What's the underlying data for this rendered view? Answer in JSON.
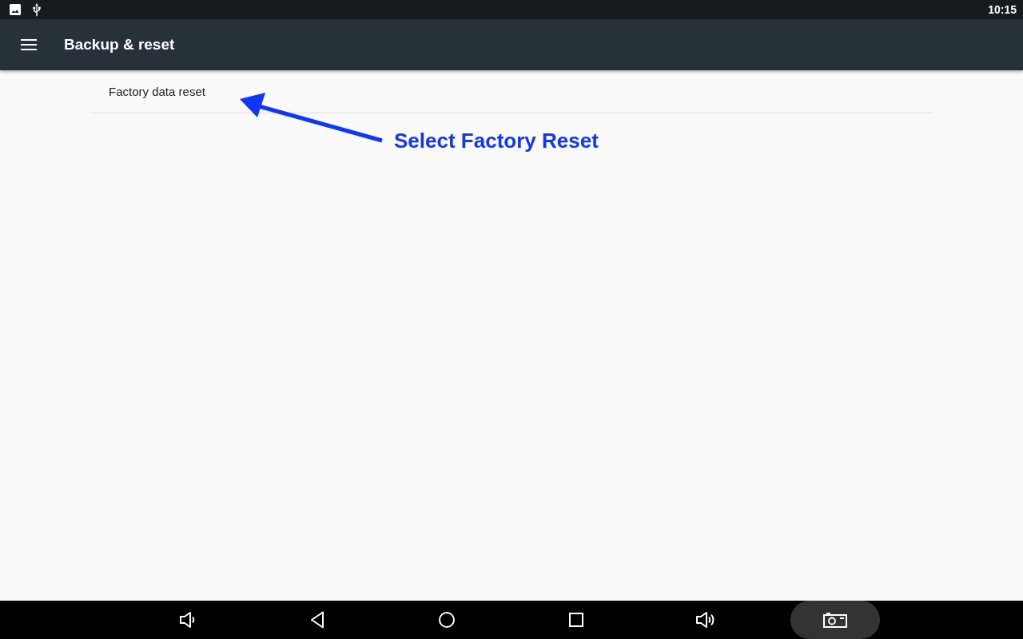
{
  "status_bar": {
    "time": "10:15"
  },
  "toolbar": {
    "title": "Backup & reset"
  },
  "settings": [
    {
      "label": "Factory data reset"
    }
  ],
  "annotation": {
    "text": "Select Factory Reset"
  }
}
